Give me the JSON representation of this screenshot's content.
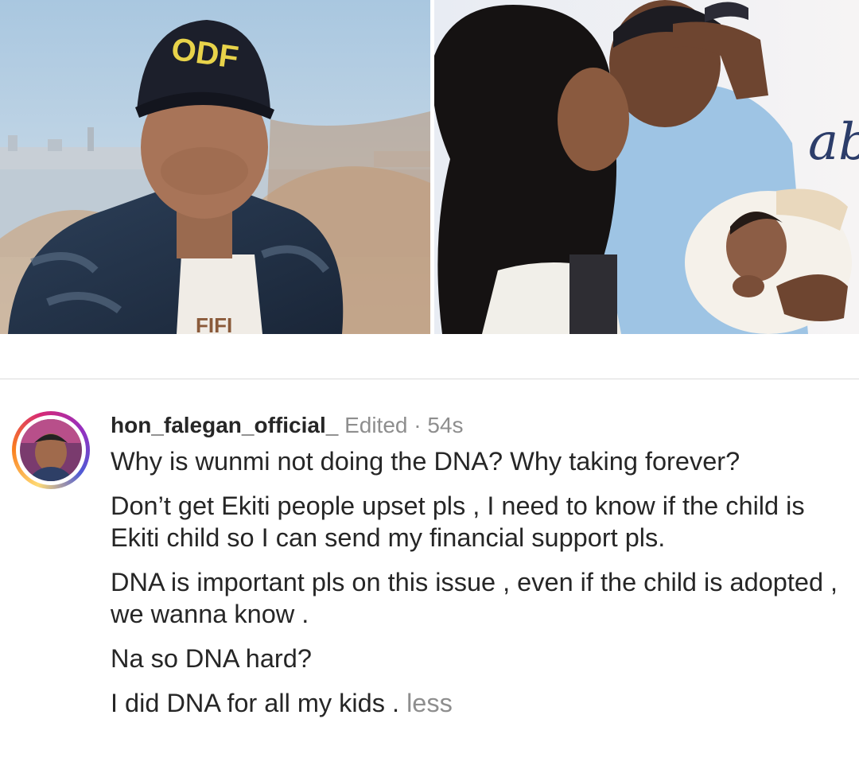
{
  "photos": {
    "left": {
      "cap_text": "ODF",
      "shirt_text": "FIFI"
    },
    "right": {
      "backdrop_text": "aby"
    }
  },
  "comment": {
    "username": "hon_falegan_official_",
    "edited_label": "Edited",
    "separator_dot": "·",
    "time": "54s",
    "paragraphs": [
      "Why is wunmi not doing the DNA?  Why taking forever?",
      "Don’t get Ekiti people upset pls , I need to know if the child is Ekiti child so I can send my financial support pls.",
      "DNA is important pls on this issue , even if the child is adopted , we wanna know .",
      "Na so DNA hard?"
    ],
    "last_paragraph": "I did DNA for all my kids .",
    "less_link": "less"
  }
}
